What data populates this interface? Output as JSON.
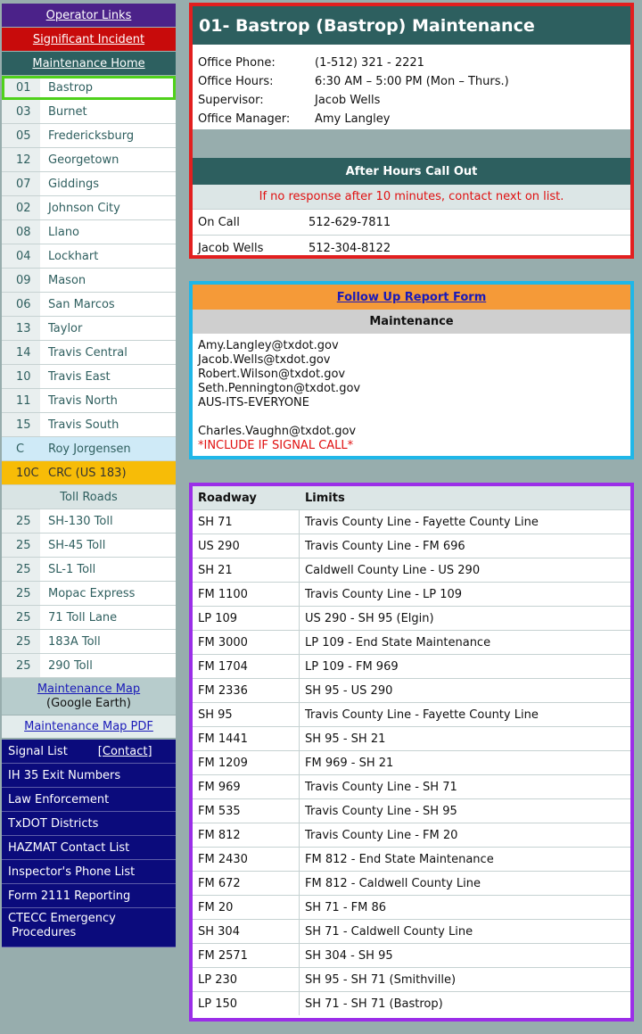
{
  "nav": {
    "operator_links": "Operator Links",
    "significant_incident": "Significant Incident",
    "maintenance_home": "Maintenance Home",
    "offices": [
      {
        "code": "01",
        "name": "Bastrop"
      },
      {
        "code": "03",
        "name": "Burnet"
      },
      {
        "code": "05",
        "name": "Fredericksburg"
      },
      {
        "code": "12",
        "name": "Georgetown"
      },
      {
        "code": "07",
        "name": "Giddings"
      },
      {
        "code": "02",
        "name": "Johnson City"
      },
      {
        "code": "08",
        "name": "Llano"
      },
      {
        "code": "04",
        "name": "Lockhart"
      },
      {
        "code": "09",
        "name": "Mason"
      },
      {
        "code": "06",
        "name": "San Marcos"
      },
      {
        "code": "13",
        "name": "Taylor"
      },
      {
        "code": "14",
        "name": "Travis Central"
      },
      {
        "code": "10",
        "name": "Travis East"
      },
      {
        "code": "11",
        "name": "Travis North"
      },
      {
        "code": "15",
        "name": "Travis South"
      },
      {
        "code": "C",
        "name": "Roy Jorgensen"
      },
      {
        "code": "10C",
        "name": "CRC (US 183)"
      }
    ],
    "toll_header": "Toll Roads",
    "tolls": [
      {
        "code": "25",
        "name": "SH-130 Toll"
      },
      {
        "code": "25",
        "name": "SH-45 Toll"
      },
      {
        "code": "25",
        "name": "SL-1 Toll"
      },
      {
        "code": "25",
        "name": "Mopac Express"
      },
      {
        "code": "25",
        "name": "71 Toll Lane"
      },
      {
        "code": "25",
        "name": "183A Toll"
      },
      {
        "code": "25",
        "name": "290 Toll"
      }
    ],
    "maintenance_map": "Maintenance Map",
    "google_earth": "(Google Earth)",
    "map_pdf": "Maintenance Map PDF",
    "signal_list": "Signal List",
    "contact": "[Contact]",
    "links": [
      "IH 35 Exit Numbers",
      "Law Enforcement",
      "TxDOT Districts",
      "HAZMAT Contact List",
      "Inspector's Phone List",
      "Form 2111 Reporting"
    ],
    "ctecc": "CTECC Emergency",
    "procedures": "Procedures"
  },
  "office": {
    "title": "01- Bastrop (Bastrop) Maintenance",
    "info": [
      {
        "k": "Office Phone:",
        "v": "(1-512) 321 - 2221"
      },
      {
        "k": "Office Hours:",
        "v": "6:30 AM – 5:00 PM (Mon – Thurs.)"
      },
      {
        "k": "Supervisor:",
        "v": "Jacob Wells"
      },
      {
        "k": "Office Manager:",
        "v": "Amy Langley"
      }
    ],
    "after_hours": "After Hours Call Out",
    "note": "If no response after 10 minutes, contact next on list.",
    "callout": [
      {
        "k": "On Call",
        "v": "512-629-7811"
      },
      {
        "k": "Jacob Wells",
        "v": "512-304-8122"
      }
    ]
  },
  "follow": {
    "title": "Follow Up Report Form",
    "sub": "Maintenance",
    "emails": [
      "Amy.Langley@txdot.gov",
      "Jacob.Wells@txdot.gov",
      "Robert.Wilson@txdot.gov",
      "Seth.Pennington@txdot.gov",
      "AUS-ITS-EVERYONE"
    ],
    "signal_email": "Charles.Vaughn@txdot.gov",
    "signal_note": "*INCLUDE IF SIGNAL CALL*"
  },
  "roads": {
    "h1": "Roadway",
    "h2": "Limits",
    "rows": [
      [
        "SH 71",
        "Travis County Line  -  Fayette County Line"
      ],
      [
        "US 290",
        "Travis County Line  -  FM 696"
      ],
      [
        "SH 21",
        "Caldwell County Line  -  US 290"
      ],
      [
        "FM 1100",
        "Travis County Line  -  LP 109"
      ],
      [
        "LP 109",
        "US 290  -  SH 95 (Elgin)"
      ],
      [
        "FM 3000",
        "LP 109  -  End State Maintenance"
      ],
      [
        "FM 1704",
        "LP 109  -  FM 969"
      ],
      [
        "FM 2336",
        "SH 95  -  US 290"
      ],
      [
        "SH 95",
        "Travis County Line  -  Fayette County Line"
      ],
      [
        "FM 1441",
        "SH 95  -  SH 21"
      ],
      [
        "FM 1209",
        "FM 969  -  SH 21"
      ],
      [
        "FM 969",
        "Travis County Line  -  SH 71"
      ],
      [
        "FM 535",
        "Travis County Line  -  SH 95"
      ],
      [
        "FM 812",
        "Travis County Line  -  FM 20"
      ],
      [
        "FM 2430",
        "FM 812  -  End State Maintenance"
      ],
      [
        "FM 672",
        "FM 812  -  Caldwell County Line"
      ],
      [
        "FM 20",
        "SH 71  -  FM 86"
      ],
      [
        "SH 304",
        "SH 71  -  Caldwell County Line"
      ],
      [
        "FM 2571",
        "SH 304  -  SH 95"
      ],
      [
        "LP 230",
        "SH 95  -  SH 71 (Smithville)"
      ],
      [
        "LP 150",
        "SH 71  -  SH 71 (Bastrop)"
      ]
    ]
  }
}
